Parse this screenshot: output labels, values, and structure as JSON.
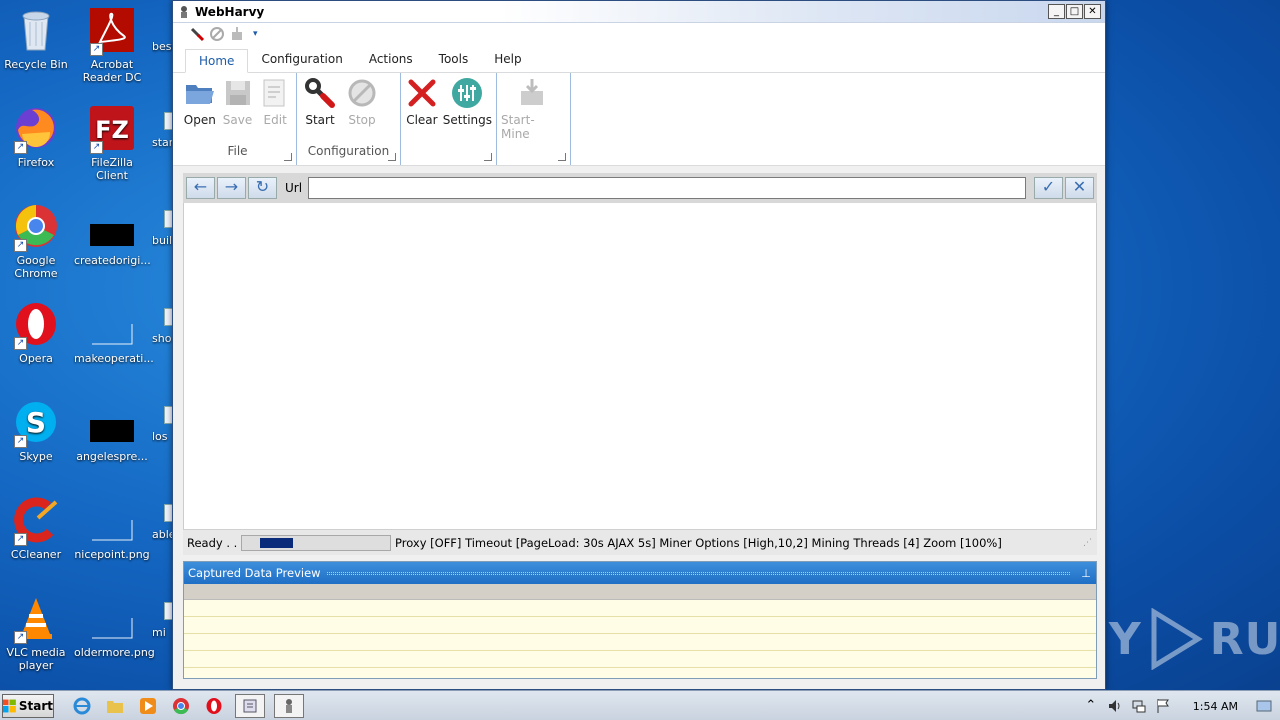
{
  "desktop": {
    "icons": [
      {
        "label": "Recycle Bin"
      },
      {
        "label": "Acrobat Reader DC"
      },
      {
        "label": "Firefox"
      },
      {
        "label": "FileZilla Client"
      },
      {
        "label": "Google Chrome"
      },
      {
        "label": "createdorigi..."
      },
      {
        "label": "Opera"
      },
      {
        "label": "makeoperati..."
      },
      {
        "label": "Skype"
      },
      {
        "label": "angelespre..."
      },
      {
        "label": "CCleaner"
      },
      {
        "label": "nicepoint.png"
      },
      {
        "label": "VLC media player"
      },
      {
        "label": "oldermore.png"
      }
    ],
    "partials": [
      "best",
      "star",
      "buil",
      "sho",
      "los",
      "able",
      "mi"
    ]
  },
  "watermark": {
    "left": "ANY",
    "right": "RUN"
  },
  "window": {
    "title": "WebHarvy",
    "controls": {
      "minimize": "_",
      "maximize": "□",
      "close": "✕"
    },
    "qat_more": "▾",
    "tabs": [
      "Home",
      "Configuration",
      "Actions",
      "Tools",
      "Help"
    ],
    "ribbon": {
      "file": {
        "name": "File",
        "open": "Open",
        "save": "Save",
        "edit": "Edit"
      },
      "configuration": {
        "name": "Configuration",
        "start": "Start",
        "stop": "Stop"
      },
      "actions": {
        "clear": "Clear",
        "settings": "Settings"
      },
      "mine": {
        "start_mine": "Start-Mine"
      }
    },
    "urlbar": {
      "back": "←",
      "forward": "→",
      "refresh": "↻",
      "label": "Url",
      "value": "",
      "ok": "✓",
      "cancel": "✕"
    },
    "status": {
      "ready": "Ready  . .",
      "progress": 0.26,
      "info": "Proxy [OFF] Timeout [PageLoad: 30s AJAX 5s] Miner Options [High,10,2] Mining Threads [4] Zoom [100%]",
      "grip": "⋰"
    },
    "preview": {
      "title": "Captured Data Preview",
      "pin": "⊥"
    }
  },
  "taskbar": {
    "start": "Start",
    "clock": "1:54 AM",
    "tray_arrow": "⌃"
  },
  "colors": {
    "accent": "#1e5ca8",
    "preview_header": "#2a7fd4",
    "progress_fill": "#0a2a7a"
  }
}
